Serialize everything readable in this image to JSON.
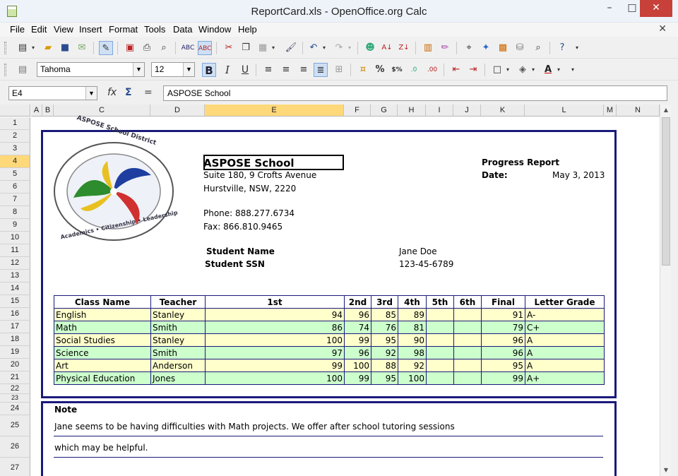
{
  "window": {
    "title": "ReportCard.xls - OpenOffice.org Calc"
  },
  "menu": [
    "File",
    "Edit",
    "View",
    "Insert",
    "Format",
    "Tools",
    "Data",
    "Window",
    "Help"
  ],
  "format_bar": {
    "font": "Tahoma",
    "size": "12"
  },
  "formula_bar": {
    "cell_ref": "E4",
    "content": "ASPOSE School",
    "fx": "fx",
    "sum": "Σ",
    "equals": "="
  },
  "columns": [
    "A",
    "B",
    "C",
    "D",
    "E",
    "F",
    "G",
    "H",
    "I",
    "J",
    "K",
    "L",
    "M",
    "N"
  ],
  "rows": [
    "1",
    "2",
    "3",
    "4",
    "5",
    "6",
    "7",
    "8",
    "9",
    "10",
    "11",
    "12",
    "13",
    "14",
    "15",
    "16",
    "17",
    "18",
    "19",
    "20",
    "21",
    "22",
    "23",
    "24",
    "25",
    "26",
    "27"
  ],
  "report": {
    "school_name": "ASPOSE School",
    "address1": "Suite 180, 9 Crofts Avenue",
    "address2": "Hurstville, NSW, 2220",
    "phone": "Phone: 888.277.6734",
    "fax": "Fax: 866.810.9465",
    "progress_label": "Progress Report",
    "date_label": "Date:",
    "date_value": "May 3, 2013",
    "student_name_label": "Student Name",
    "student_name_value": "Jane Doe",
    "student_ssn_label": "Student SSN",
    "student_ssn_value": "123-45-6789",
    "logo_text_top": "ASPOSE School District",
    "logo_text_bottom": "Academics • Citizenship • Leadership"
  },
  "grades": {
    "headers": [
      "Class Name",
      "Teacher",
      "1st",
      "2nd",
      "3rd",
      "4th",
      "5th",
      "6th",
      "Final",
      "Letter Grade"
    ],
    "rows": [
      [
        "English",
        "Stanley",
        "94",
        "96",
        "85",
        "89",
        "",
        "",
        "91",
        "A-"
      ],
      [
        "Math",
        "Smith",
        "86",
        "74",
        "76",
        "81",
        "",
        "",
        "79",
        "C+"
      ],
      [
        "Social Studies",
        "Stanley",
        "100",
        "99",
        "95",
        "90",
        "",
        "",
        "96",
        "A"
      ],
      [
        "Science",
        "Smith",
        "97",
        "96",
        "92",
        "98",
        "",
        "",
        "96",
        "A"
      ],
      [
        "Art",
        "Anderson",
        "99",
        "100",
        "88",
        "92",
        "",
        "",
        "95",
        "A"
      ],
      [
        "Physical Education",
        "Jones",
        "100",
        "99",
        "95",
        "100",
        "",
        "",
        "99",
        "A+"
      ]
    ]
  },
  "note": {
    "label": "Note",
    "line1": "Jane seems to be having difficulties with Math projects.  We offer after school tutoring sessions",
    "line2": "which may be helpful."
  },
  "colors": {
    "frame": "#1a1a7a",
    "row_yellow": "#ffffcc",
    "row_green": "#ccffcc",
    "selection": "#ffd87a"
  }
}
